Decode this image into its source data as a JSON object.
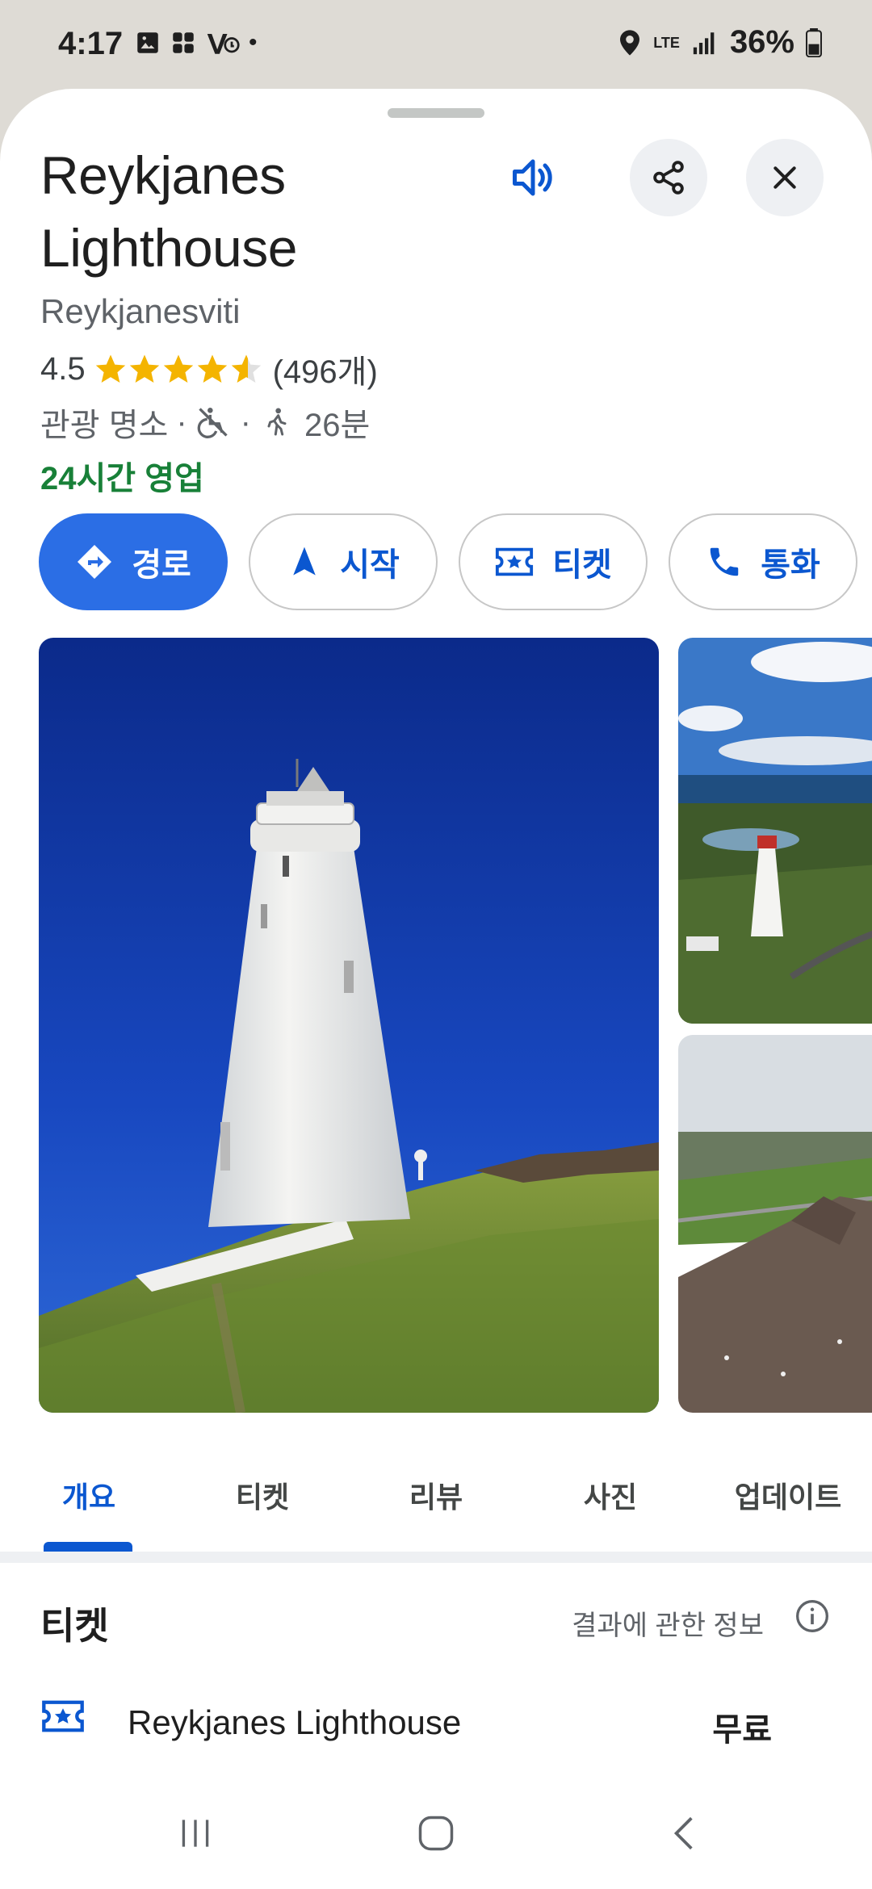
{
  "status_bar": {
    "time": "4:17",
    "dot": "•",
    "network": "LTE",
    "battery": "36%"
  },
  "place": {
    "name": "Reykjanes Lighthouse",
    "local_name": "Reykjanesviti",
    "rating": "4.5",
    "rating_value": 4.5,
    "review_count": "(496개)",
    "category": "관광 명소",
    "separator": "·",
    "walk_time": "26분",
    "hours": "24시간 영업"
  },
  "actions": {
    "directions": "경로",
    "start": "시작",
    "tickets": "티켓",
    "call": "통화"
  },
  "tabs": {
    "overview": "개요",
    "tickets": "티켓",
    "reviews": "리뷰",
    "photos": "사진",
    "updates": "업데이트"
  },
  "tickets_section": {
    "title": "티켓",
    "results_info": "결과에 관한 정보",
    "item_name": "Reykjanes Lighthouse",
    "item_price": "무료"
  },
  "colors": {
    "accent": "#0b57d0",
    "primary_button": "#2b6ee5",
    "open_green": "#188038",
    "star": "#f4b400"
  },
  "icons": {
    "speaker": "speaker-icon",
    "share": "share-icon",
    "close": "close-icon",
    "directions": "directions-icon",
    "start": "navigation-arrow-icon",
    "tickets": "ticket-icon",
    "call": "phone-icon",
    "info": "info-icon",
    "wheelchair": "no-wheelchair-icon",
    "walk": "walking-icon"
  }
}
